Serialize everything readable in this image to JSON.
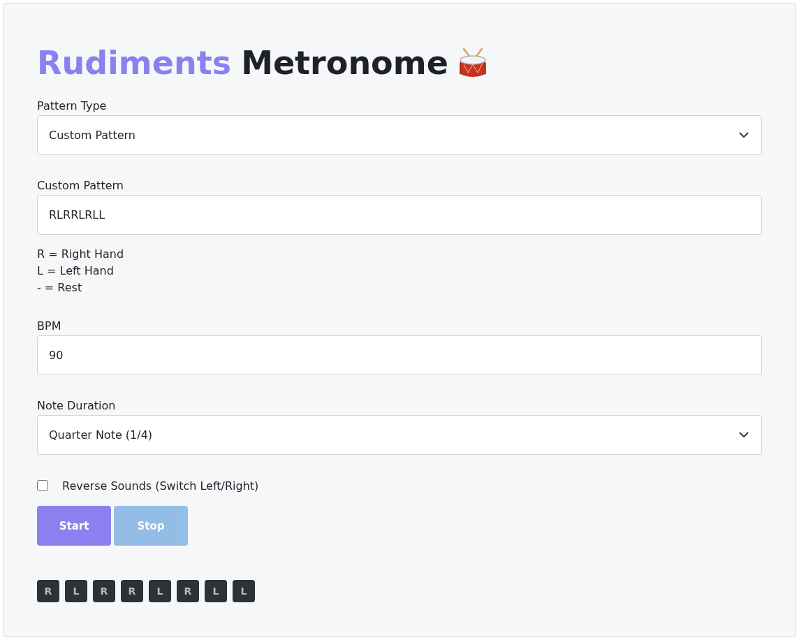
{
  "title": {
    "accent": "Rudiments",
    "rest": "Metronome"
  },
  "fields": [
    {
      "kind": "select",
      "label": "Pattern Type",
      "value": "Custom Pattern"
    },
    {
      "kind": "input",
      "label": "Custom Pattern",
      "value": "RLRRLRLL",
      "help": [
        "R = Right Hand",
        "L = Left Hand",
        "- = Rest"
      ]
    },
    {
      "kind": "input",
      "label": "BPM",
      "value": "90"
    },
    {
      "kind": "select",
      "label": "Note Duration",
      "value": "Quarter Note (1/4)"
    }
  ],
  "reverse": {
    "label": "Reverse Sounds (Switch Left/Right)",
    "checked": false
  },
  "buttons": [
    {
      "label": "Start",
      "kind": "primary",
      "disabled": false
    },
    {
      "label": "Stop",
      "kind": "secondary",
      "disabled": true
    }
  ],
  "steps": [
    "R",
    "L",
    "R",
    "R",
    "L",
    "R",
    "L",
    "L"
  ]
}
